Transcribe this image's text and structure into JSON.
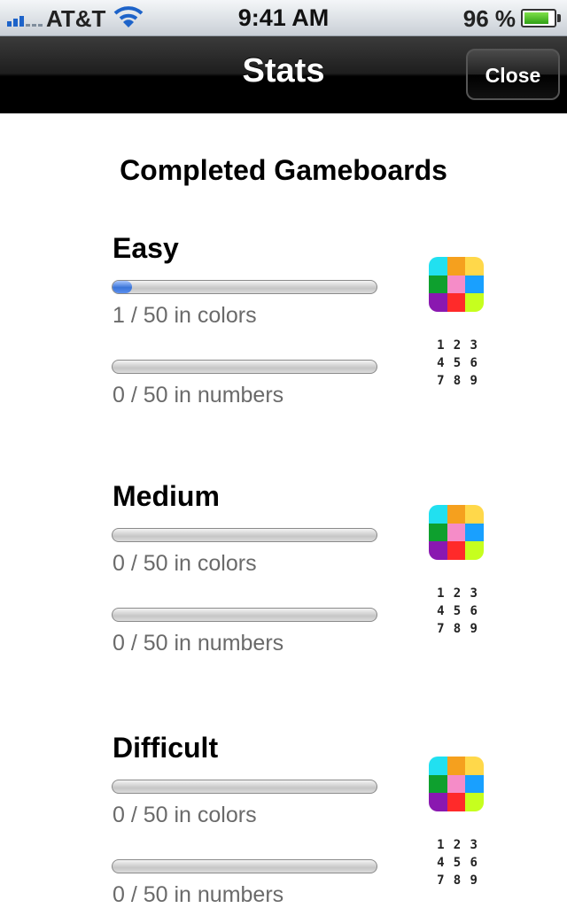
{
  "status": {
    "carrier": "AT&T",
    "time": "9:41 AM",
    "battery_pct": "96 %",
    "battery_level": 0.96
  },
  "nav": {
    "title": "Stats",
    "close_label": "Close"
  },
  "section_title": "Completed Gameboards",
  "icon_colors": [
    "#21e0f0",
    "#f5a01e",
    "#ffd84a",
    "#0ea02e",
    "#f58cc8",
    "#19a0ff",
    "#8a18b0",
    "#ff2a2a",
    "#c6ff1e"
  ],
  "icon_numbers": [
    "1",
    "2",
    "3",
    "4",
    "5",
    "6",
    "7",
    "8",
    "9"
  ],
  "levels": [
    {
      "name": "Easy",
      "colors": {
        "label": "1 / 50 in colors",
        "progress": 0.02
      },
      "numbers": {
        "label": "0 / 50 in numbers",
        "progress": 0
      }
    },
    {
      "name": "Medium",
      "colors": {
        "label": "0 / 50 in colors",
        "progress": 0
      },
      "numbers": {
        "label": "0 / 50 in numbers",
        "progress": 0
      }
    },
    {
      "name": "Difficult",
      "colors": {
        "label": "0 / 50 in colors",
        "progress": 0
      },
      "numbers": {
        "label": "0 / 50 in numbers",
        "progress": 0
      }
    }
  ]
}
